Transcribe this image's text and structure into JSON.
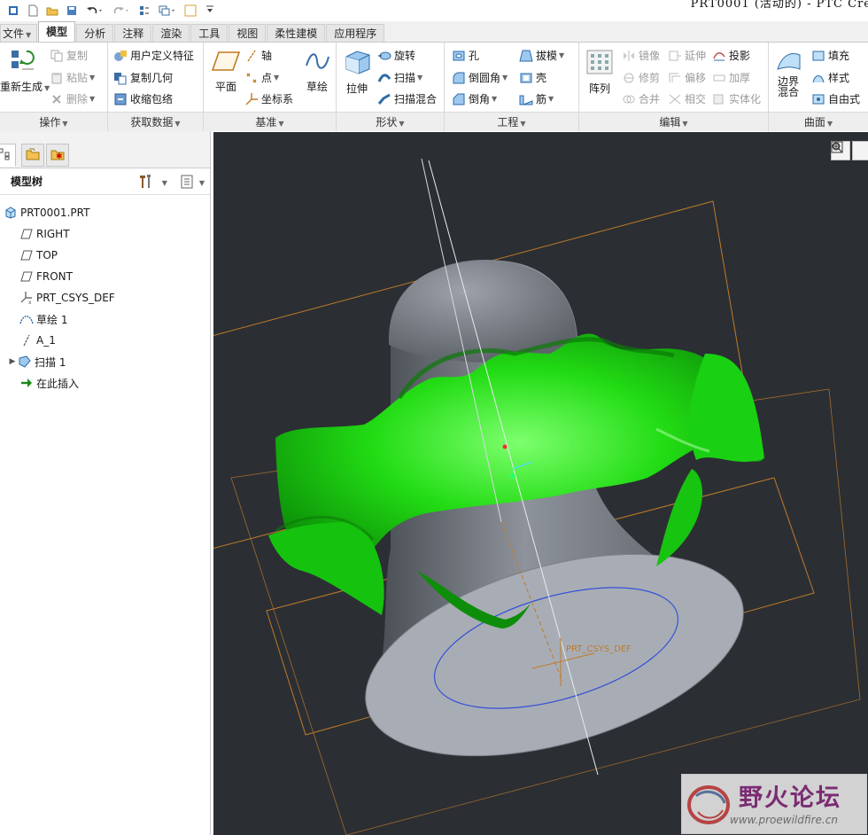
{
  "window": {
    "title": "PRT0001 (活动的) - PTC Cre"
  },
  "tabs": [
    {
      "label": "文件",
      "active": false
    },
    {
      "label": "模型",
      "active": true
    },
    {
      "label": "分析",
      "active": false
    },
    {
      "label": "注释",
      "active": false
    },
    {
      "label": "渲染",
      "active": false
    },
    {
      "label": "工具",
      "active": false
    },
    {
      "label": "视图",
      "active": false
    },
    {
      "label": "柔性建模",
      "active": false
    },
    {
      "label": "应用程序",
      "active": false
    }
  ],
  "ribbon": {
    "operations": {
      "label": "操作",
      "regenerate": "重新生成",
      "copy": "复制",
      "paste": "粘贴",
      "delete": "删除"
    },
    "get_data": {
      "label": "获取数据",
      "udf": "用户定义特征",
      "copy_geom": "复制几何",
      "shrinkwrap": "收缩包络"
    },
    "datum": {
      "label": "基准",
      "plane": "平面",
      "axis": "轴",
      "point": "点",
      "csys": "坐标系",
      "sketch": "草绘"
    },
    "shapes": {
      "label": "形状",
      "extrude": "拉伸",
      "revolve": "旋转",
      "sweep": "扫描",
      "swept_blend": "扫描混合"
    },
    "engineering": {
      "label": "工程",
      "hole": "孔",
      "round": "倒圆角",
      "chamfer": "倒角",
      "draft": "拔模",
      "shell": "壳",
      "rib": "筋"
    },
    "editing": {
      "label": "编辑",
      "pattern": "阵列",
      "mirror": "镜像",
      "extend": "延伸",
      "project": "投影",
      "trim": "修剪",
      "offset": "偏移",
      "thicken": "加厚",
      "merge": "合并",
      "intersect": "相交",
      "solidify": "实体化"
    },
    "surfaces": {
      "label": "曲面",
      "boundary_blend": "边界混合",
      "fill": "填充",
      "style": "样式",
      "freestyle": "自由式"
    }
  },
  "model_tree": {
    "header": "模型树",
    "items": [
      {
        "label": "PRT0001.PRT",
        "icon": "part-icon"
      },
      {
        "label": "RIGHT",
        "icon": "datum-plane-icon"
      },
      {
        "label": "TOP",
        "icon": "datum-plane-icon"
      },
      {
        "label": "FRONT",
        "icon": "datum-plane-icon"
      },
      {
        "label": "PRT_CSYS_DEF",
        "icon": "csys-icon"
      },
      {
        "label": "草绘 1",
        "icon": "sketch-icon"
      },
      {
        "label": "A_1",
        "icon": "axis-icon"
      },
      {
        "label": "扫描 1",
        "icon": "sweep-icon"
      },
      {
        "label": "在此插入",
        "icon": "insert-here-arrow-icon"
      }
    ]
  },
  "viewport": {
    "csys_label": "PRT_CSYS_DEF",
    "background": "#2b2f33",
    "surface_color": "#1fe51a",
    "solid_color": "#8c9097",
    "datum_color": "#c87a2a"
  },
  "watermark": {
    "title": "野火论坛",
    "url": "www.proewildfire.cn"
  }
}
